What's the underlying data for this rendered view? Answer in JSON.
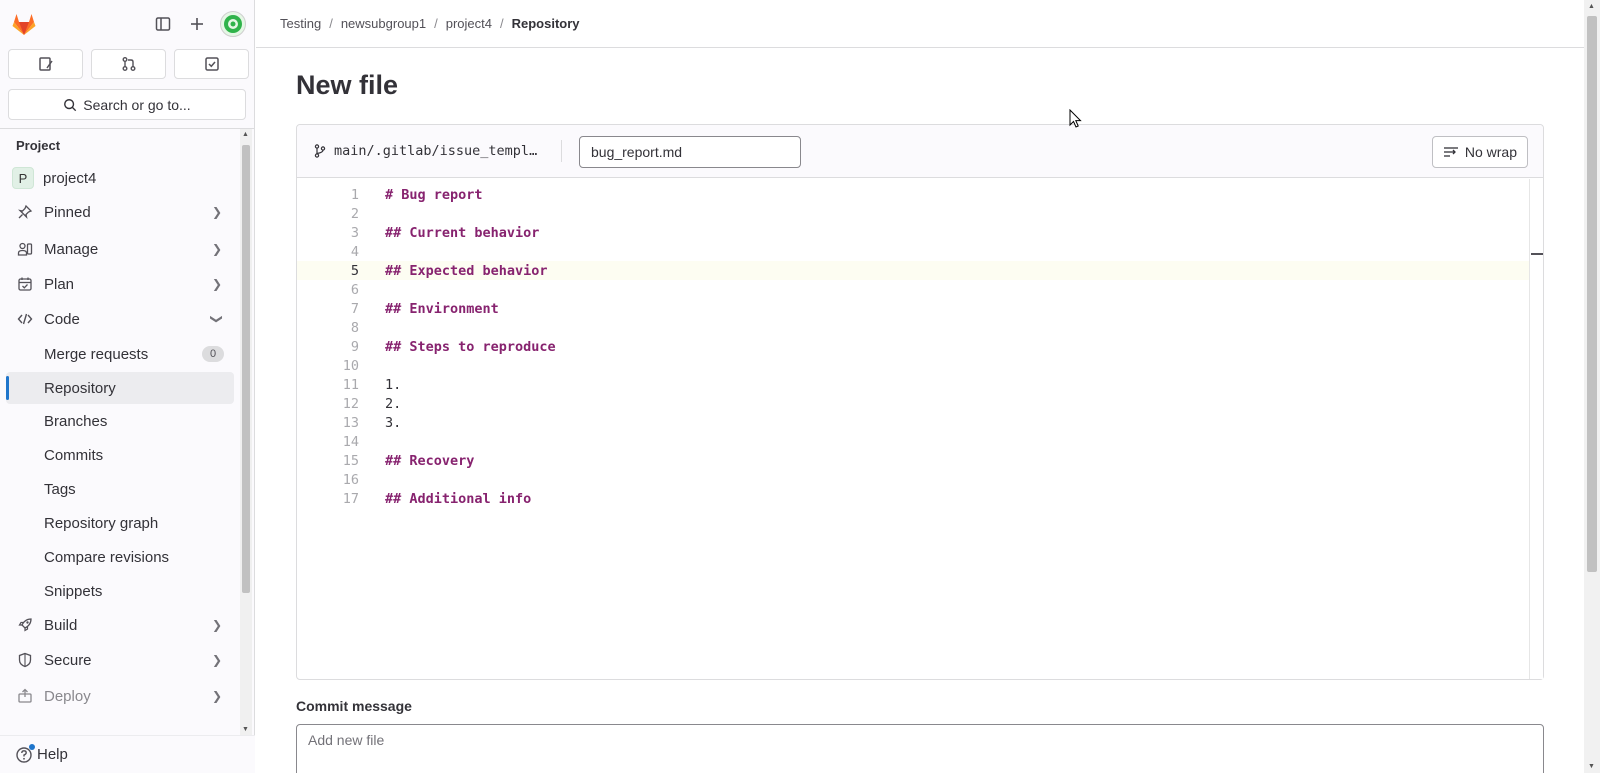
{
  "sidebar": {
    "search_label": "Search or go to...",
    "section_title": "Project",
    "project_name": "project4",
    "project_initial": "P",
    "items": {
      "pinned": "Pinned",
      "manage": "Manage",
      "plan": "Plan",
      "code": "Code",
      "merge_requests": "Merge requests",
      "merge_requests_count": "0",
      "repository": "Repository",
      "branches": "Branches",
      "commits": "Commits",
      "tags": "Tags",
      "repository_graph": "Repository graph",
      "compare_revisions": "Compare revisions",
      "snippets": "Snippets",
      "build": "Build",
      "secure": "Secure",
      "deploy": "Deploy"
    },
    "help_label": "Help"
  },
  "breadcrumb": {
    "group": "Testing",
    "subgroup": "newsubgroup1",
    "project": "project4",
    "current": "Repository",
    "separator": "/"
  },
  "page": {
    "title": "New file"
  },
  "editor": {
    "branch_path": "main/.gitlab/issue_templ…",
    "filename": "bug_report.md",
    "nowrap_label": "No wrap",
    "current_line": 5,
    "lines": [
      {
        "n": "1",
        "text": "# Bug report",
        "heading": true
      },
      {
        "n": "2",
        "text": "",
        "heading": false
      },
      {
        "n": "3",
        "text": "## Current behavior",
        "heading": true
      },
      {
        "n": "4",
        "text": "",
        "heading": false
      },
      {
        "n": "5",
        "text": "## Expected behavior",
        "heading": true
      },
      {
        "n": "6",
        "text": "",
        "heading": false
      },
      {
        "n": "7",
        "text": "## Environment",
        "heading": true
      },
      {
        "n": "8",
        "text": "",
        "heading": false
      },
      {
        "n": "9",
        "text": "## Steps to reproduce",
        "heading": true
      },
      {
        "n": "10",
        "text": "",
        "heading": false
      },
      {
        "n": "11",
        "text": "1.",
        "heading": false
      },
      {
        "n": "12",
        "text": "2.",
        "heading": false
      },
      {
        "n": "13",
        "text": "3.",
        "heading": false
      },
      {
        "n": "14",
        "text": "",
        "heading": false
      },
      {
        "n": "15",
        "text": "## Recovery",
        "heading": true
      },
      {
        "n": "16",
        "text": "",
        "heading": false
      },
      {
        "n": "17",
        "text": "## Additional info",
        "heading": true
      }
    ]
  },
  "commit": {
    "label": "Commit message",
    "placeholder": "Add new file"
  },
  "icons": {
    "logo": "gitlab-tanuki-icon",
    "sidebar_toggle": "sidebar-toggle-icon",
    "new": "plus-icon",
    "issues": "issues-icon",
    "merge_requests": "merge-request-icon",
    "todos": "todo-icon",
    "search": "search-icon",
    "branch": "branch-icon",
    "nowrap": "nowrap-icon"
  },
  "colors": {
    "accent": "#1f75cb",
    "heading_text": "#87236f",
    "logo_orange": "#fc6d26"
  }
}
